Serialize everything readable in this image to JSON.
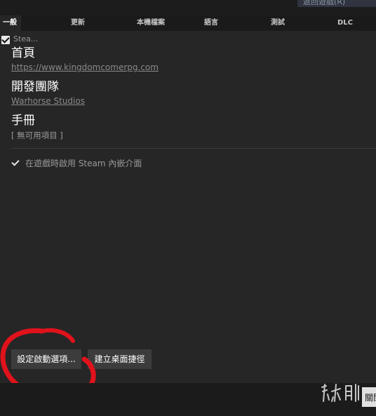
{
  "top_button": {
    "label": "返回遊戲(R)"
  },
  "tabs": [
    {
      "label": "一般"
    },
    {
      "label": "更新"
    },
    {
      "label": "本機檔案"
    },
    {
      "label": "語言"
    },
    {
      "label": "測試"
    },
    {
      "label": "DLC"
    }
  ],
  "general": {
    "stea_label": "Stea...",
    "homepage_heading": "首頁",
    "homepage_url": "https://www.kingdomcomerpg.com",
    "developer_heading": "開發團隊",
    "developer_name": "Warhorse Studios",
    "manual_heading": "手冊",
    "manual_value": "[ 無可用項目 ]",
    "overlay_label": "在遊戲時啟用 Steam 內嵌介面"
  },
  "buttons": {
    "launch_options": "設定啟動選項...",
    "desktop_shortcut": "建立桌面捷徑"
  },
  "footer": {
    "close_label": "關閉"
  },
  "colors": {
    "annotation": "#e0121b",
    "background": "#262626",
    "tabbar": "#1a1a1a",
    "button": "#3c3c3c"
  }
}
